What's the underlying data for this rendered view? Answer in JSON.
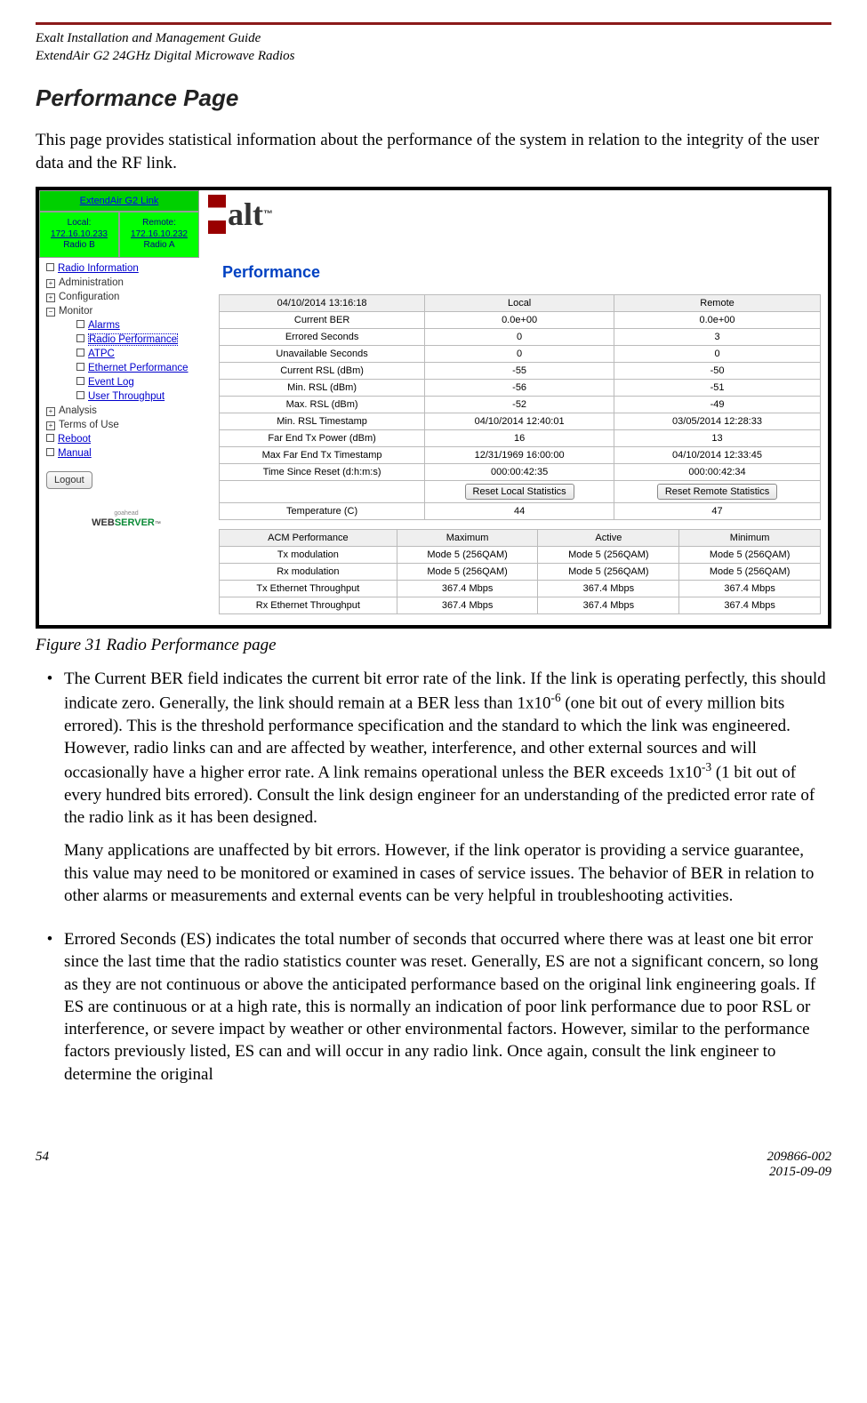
{
  "header": {
    "l1": "Exalt Installation and Management Guide",
    "l2": "ExtendAir G2 24GHz Digital Microwave Radios"
  },
  "heading": "Performance Page",
  "intro": "This page provides statistical information about the performance of the system in relation to the integrity of the user data and the RF link.",
  "figcap": "Figure 31   Radio Performance page",
  "ui": {
    "link": "ExtendAir G2 Link",
    "local": {
      "t": "Local:",
      "ip": "172.16.10.233",
      "r": "Radio B"
    },
    "remote": {
      "t": "Remote:",
      "ip": "172.16.10.232",
      "r": "Radio A"
    },
    "ptitle": "Performance",
    "side": {
      "radioinfo": "Radio Information",
      "admin": "Administration",
      "config": "Configuration",
      "monitor": "Monitor",
      "alarms": "Alarms",
      "radperf": "Radio Performance",
      "atpc": "ATPC",
      "eth": "Ethernet Performance",
      "evlog": "Event Log",
      "uthr": "User Throughput",
      "analysis": "Analysis",
      "terms": "Terms of Use",
      "reboot": "Reboot",
      "manual": "Manual",
      "logout": "Logout"
    },
    "t1": {
      "ts": "04/10/2014 13:16:18",
      "hL": "Local",
      "hR": "Remote",
      "rows": [
        {
          "l": "Current BER",
          "a": "0.0e+00",
          "b": "0.0e+00"
        },
        {
          "l": "Errored Seconds",
          "a": "0",
          "b": "3"
        },
        {
          "l": "Unavailable Seconds",
          "a": "0",
          "b": "0"
        },
        {
          "l": "Current RSL (dBm)",
          "a": "-55",
          "b": "-50"
        },
        {
          "l": "Min. RSL (dBm)",
          "a": "-56",
          "b": "-51"
        },
        {
          "l": "Max. RSL (dBm)",
          "a": "-52",
          "b": "-49"
        },
        {
          "l": "Min. RSL Timestamp",
          "a": "04/10/2014 12:40:01",
          "b": "03/05/2014 12:28:33"
        },
        {
          "l": "Far End Tx Power (dBm)",
          "a": "16",
          "b": "13"
        },
        {
          "l": "Max Far End Tx Timestamp",
          "a": "12/31/1969 16:00:00",
          "b": "04/10/2014 12:33:45"
        },
        {
          "l": "Time Since Reset (d:h:m:s)",
          "a": "000:00:42:35",
          "b": "000:00:42:34"
        }
      ],
      "btnL": "Reset Local Statistics",
      "btnR": "Reset Remote Statistics",
      "temp": {
        "l": "Temperature (C)",
        "a": "44",
        "b": "47"
      }
    },
    "t2": {
      "h": [
        "ACM Performance",
        "Maximum",
        "Active",
        "Minimum"
      ],
      "rows": [
        {
          "l": "Tx modulation",
          "a": "Mode 5 (256QAM)",
          "b": "Mode 5 (256QAM)",
          "c": "Mode 5 (256QAM)"
        },
        {
          "l": "Rx modulation",
          "a": "Mode 5 (256QAM)",
          "b": "Mode 5 (256QAM)",
          "c": "Mode 5 (256QAM)"
        },
        {
          "l": "Tx Ethernet Throughput",
          "a": "367.4 Mbps",
          "b": "367.4 Mbps",
          "c": "367.4 Mbps"
        },
        {
          "l": "Rx Ethernet Throughput",
          "a": "367.4 Mbps",
          "b": "367.4 Mbps",
          "c": "367.4 Mbps"
        }
      ]
    }
  },
  "bullets": {
    "b1p1a": "The Current BER field indicates the current bit error rate of the link. If the link is operating perfectly, this should indicate zero. Generally, the link should remain at a BER less than 1x10",
    "b1p1b": " (one bit out of every million bits errored). This is the threshold performance specification and the standard to which the link was engineered. However, radio links can and are affected by weather, interference, and other external sources and will occasionally have a higher error rate. A link remains operational unless the BER exceeds 1x10",
    "b1p1c": " (1 bit out of every hundred bits errored). Consult the link design engineer for an understanding of the predicted error rate of the radio link as it has been designed.",
    "b1p2": "Many applications are unaffected by bit errors. However, if the link operator is providing a service guarantee, this value may need to be monitored or examined in cases of service issues. The behavior of BER in relation to other alarms or measurements and external events can be very helpful in troubleshooting activities.",
    "b2": "Errored Seconds (ES) indicates the total number of seconds that occurred where there was at least one bit error since the last time that the radio statistics counter was reset. Generally, ES are not a significant concern, so long as they are not continuous or above the anticipated performance based on the original link engineering goals. If ES are continuous or at a high rate, this is normally an indication of poor link performance due to poor RSL or interference, or severe impact by weather or other environmental factors. However, similar to the performance factors previously listed, ES can and will occur in any radio link. Once again, consult the link engineer to determine the original"
  },
  "footer": {
    "page": "54",
    "doc": "209866-002",
    "date": "2015-09-09"
  }
}
